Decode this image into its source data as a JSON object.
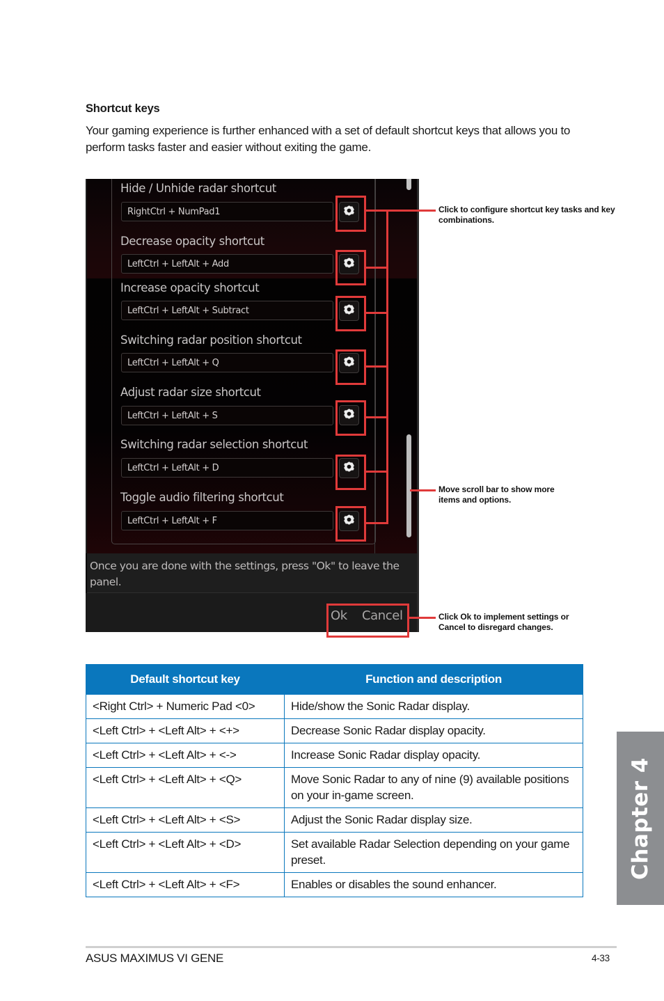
{
  "section": {
    "title": "Shortcut keys",
    "intro": "Your gaming experience is further enhanced with a set of default shortcut keys that allows you to perform tasks faster and easier without exiting the game."
  },
  "panel": {
    "items": [
      {
        "label": "Hide / Unhide radar shortcut",
        "value": "RightCtrl + NumPad1",
        "icon": "gear-icon"
      },
      {
        "label": "Decrease opacity shortcut",
        "value": "LeftCtrl + LeftAlt + Add",
        "icon": "gear-icon"
      },
      {
        "label": "Increase opacity shortcut",
        "value": "LeftCtrl + LeftAlt + Subtract",
        "icon": "gear-icon"
      },
      {
        "label": "Switching radar position shortcut",
        "value": "LeftCtrl + LeftAlt + Q",
        "icon": "gear-icon"
      },
      {
        "label": "Adjust radar size shortcut",
        "value": "LeftCtrl + LeftAlt + S",
        "icon": "gear-icon"
      },
      {
        "label": "Switching radar selection shortcut",
        "value": "LeftCtrl + LeftAlt + D",
        "icon": "gear-icon"
      },
      {
        "label": "Toggle audio filtering shortcut",
        "value": "LeftCtrl + LeftAlt + F",
        "icon": "gear-icon"
      }
    ],
    "info_text": "Once you are done with the settings, press \"Ok\" to leave the panel.",
    "ok_label": "Ok",
    "cancel_label": "Cancel"
  },
  "callouts": {
    "configure": "Click to configure shortcut key tasks and key combinations.",
    "scroll": "Move scroll bar to show more items and options.",
    "ok_cancel": "Click Ok to implement settings or Cancel to disregard changes."
  },
  "colors": {
    "callout_red": "#e03a3a",
    "table_header_blue": "#0a77bd",
    "chapter_tab_gray": "#8c8e91"
  },
  "table": {
    "headers": [
      "Default shortcut key",
      "Function and description"
    ],
    "rows": [
      {
        "key": "<Right Ctrl> + Numeric Pad <0>",
        "desc": "Hide/show the Sonic Radar display."
      },
      {
        "key": "<Left Ctrl> + <Left Alt> + <+>",
        "desc": "Decrease Sonic Radar display opacity."
      },
      {
        "key": "<Left Ctrl> + <Left Alt> + <->",
        "desc": "Increase Sonic Radar display opacity."
      },
      {
        "key": "<Left Ctrl> + <Left Alt> + <Q>",
        "desc": "Move Sonic Radar to any of nine (9) available positions on your in-game screen."
      },
      {
        "key": "<Left Ctrl> + <Left Alt> + <S>",
        "desc": "Adjust the Sonic Radar display size."
      },
      {
        "key": "<Left Ctrl> + <Left Alt> + <D>",
        "desc": "Set available Radar Selection depending on your game preset."
      },
      {
        "key": "<Left Ctrl> + <Left Alt> + <F>",
        "desc": "Enables or disables the sound enhancer."
      }
    ]
  },
  "chapter_tab": "Chapter 4",
  "footer": {
    "product": "ASUS MAXIMUS VI GENE",
    "page": "4-33"
  }
}
